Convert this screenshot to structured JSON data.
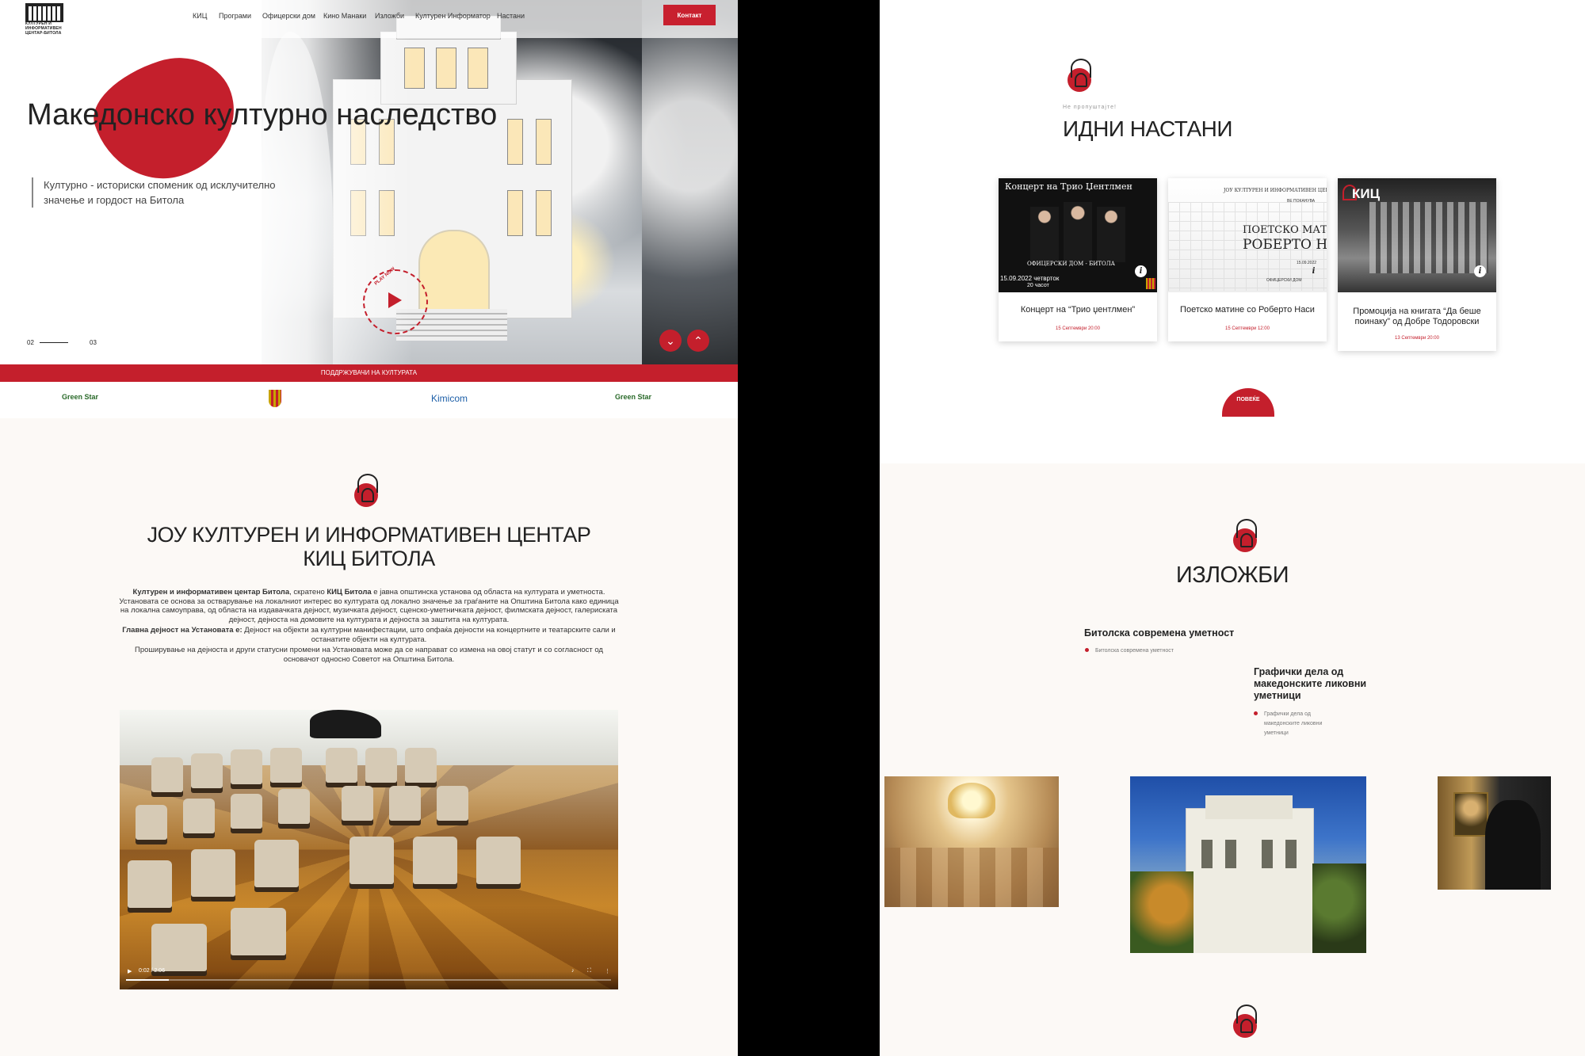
{
  "left_page": {
    "logo": {
      "lines": [
        "КУЛТУРЕН И",
        "ИНФОРМАТИВЕН",
        "ЦЕНТАР-БИТОЛА"
      ]
    },
    "nav": [
      "КИЦ",
      "Програми",
      "Офицерски дом",
      "Кино Манаки",
      "Изложби",
      "Културен Информатор",
      "Настани"
    ],
    "contact_label": "Контакт",
    "hero": {
      "title": "Македонско културно наследство",
      "subtitle": "Културно - историски споменик од исклучително значење и гордост на Битола",
      "slide_current": "02",
      "slide_next": "03",
      "play_ring_text": "PLAY NOW"
    },
    "sponsors": {
      "bar_label": "ПОДДРЖУВАЧИ НА КУЛТУРАТА",
      "items": [
        "Green Star",
        "Kimicom",
        "Green Star"
      ]
    },
    "about": {
      "title_line1": "ЈОУ КУЛТУРЕН И ИНФОРМАТИВЕН ЦЕНТАР",
      "title_line2": "КИЦ БИТОЛА",
      "p1_bold1": "Културен и информативен центар Битола",
      "p1_mid": ", скратено ",
      "p1_bold2": "КИЦ Битола",
      "p1_rest": " е јавна општинска установа од областа на културата и уметноста. Установата се основа за остварување на локалниот интерес во културата од локално значење за граѓаните на Општина Битола како единица на локална самоуправа, од областа на издавачката дејност, музичката дејност, сценско-уметничката дејност, филмската дејност, галериската дејност, дејноста на домовите на културата и дејноста за заштита на културата.",
      "p2_bold": "Главна дејност на Установата е:",
      "p2_rest": " Дејност на објекти за културни манифестации, што опфаќа дејности на концертните и театарските сали и останатите објекти на културата.",
      "p3": "Проширување на дејноста и други статусни промени на Установата може да се направат со измена на овој статут и со согласност од основачот односно Советот на Општина Битола."
    },
    "video": {
      "time": "0:02 / 2:06"
    }
  },
  "right_page": {
    "events": {
      "subtitle": "Не пропуштајте!",
      "title": "ИДНИ НАСТАНИ",
      "cards": [
        {
          "img_title": "Концерт на Трио Џентлмен",
          "img_place": "ОФИЦЕРСКИ ДОМ - БИТОЛА",
          "img_date": "15.09.2022 четврток",
          "img_time": "20 часот",
          "caption": "Концерт на “Трио џентлмен”",
          "date": "15 Септември 20:00"
        },
        {
          "img_title": "ЈОУ КУЛТУРЕН И ИНФОРМАТИВЕН ЦЕНТАР",
          "img_sub": "ВЕ ПОКАНУВА",
          "img_big1": "ПОЕТСКО МАТИНЕ",
          "img_big2": "РОБЕРТО НАСИ",
          "img_date": "15.09.2022",
          "img_place": "ОФИЦЕРСКИ ДОМ",
          "caption": "Поетско матине со Роберто Наси",
          "date": "15 Септември 12:00"
        },
        {
          "img_badge": "КИЦ",
          "caption": "Промоција на книгата “Да беше поинаку” од Добре Тодоровски",
          "date": "13 Септември 20:00"
        }
      ],
      "more_label": "ПОВЕЌЕ",
      "info_glyph": "i"
    },
    "exhibitions": {
      "title": "ИЗЛОЖБИ",
      "items": [
        {
          "title": "Битолска современа уметност",
          "sub": "Битолска современа уметност"
        },
        {
          "title": "Графички дела од македонските ликовни уметници",
          "sub": "Графички дела од македонските ликовни уметници"
        }
      ]
    }
  },
  "colors": {
    "accent": "#c41f2c",
    "background": "#fcf9f6",
    "divider": "#000000"
  }
}
